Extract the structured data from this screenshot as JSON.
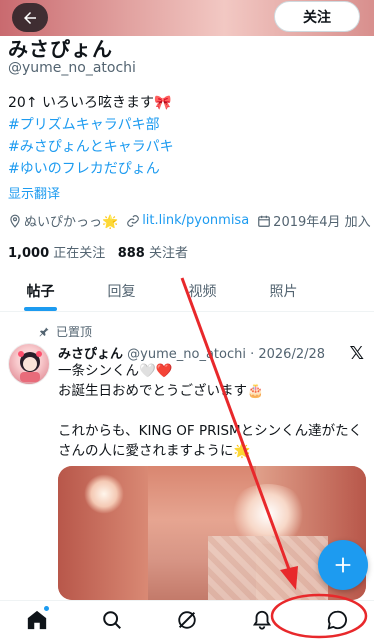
{
  "header": {
    "follow_label": "关注",
    "back_icon": "arrow-left-icon"
  },
  "profile": {
    "name": "みさぴょん",
    "handle": "@yume_no_atochi",
    "bio_line1": "20↑ いろいろ呟きます🎀",
    "bio_tags": [
      "#プリズムキャラパキ部",
      "#みさぴょんとキャラパキ",
      "#ゆいのフレカだぴょん"
    ],
    "translate_label": "显示翻译",
    "location": "ぬいぴかっっ🌟",
    "url": "lit.link/pyonmisa",
    "joined": "2019年4月 加入",
    "following_count": "1,000",
    "following_label": "正在关注",
    "followers_count": "888",
    "followers_label": "关注者"
  },
  "tabs": [
    "帖子",
    "回复",
    "视频",
    "照片"
  ],
  "tweet": {
    "pinned_label": "已置顶",
    "author": "みさぴょん",
    "handle": "@yume_no_atochi",
    "date": "· 2026/2/28",
    "line1": "一条シンくん🤍❤️",
    "line2": "お誕生日おめでとうございます🎂",
    "line3": "これからも、KING OF PRISMとシンくん達がたくさんの人に愛されますように🌟"
  },
  "colors": {
    "accent": "#1d9bf0",
    "annotation": "#e8282b"
  },
  "nav_icons": [
    "home-icon",
    "search-icon",
    "grok-icon",
    "notifications-icon",
    "messages-icon"
  ]
}
